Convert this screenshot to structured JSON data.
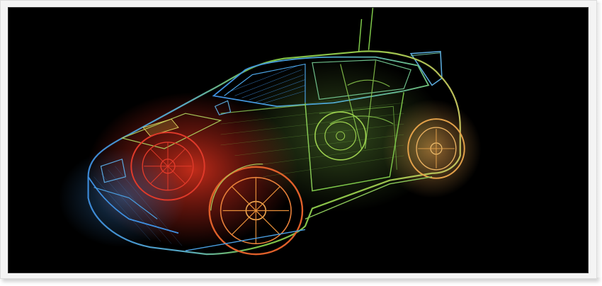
{
  "image": {
    "subject": "wireframe-car",
    "background_color": "#000000",
    "frame_color": "#f4f4f4",
    "colors": {
      "blue": "#3f8fe0",
      "green": "#7fc94a",
      "yellow": "#d6c95a",
      "orange": "#e3a14a",
      "red": "#e03a2a"
    }
  }
}
